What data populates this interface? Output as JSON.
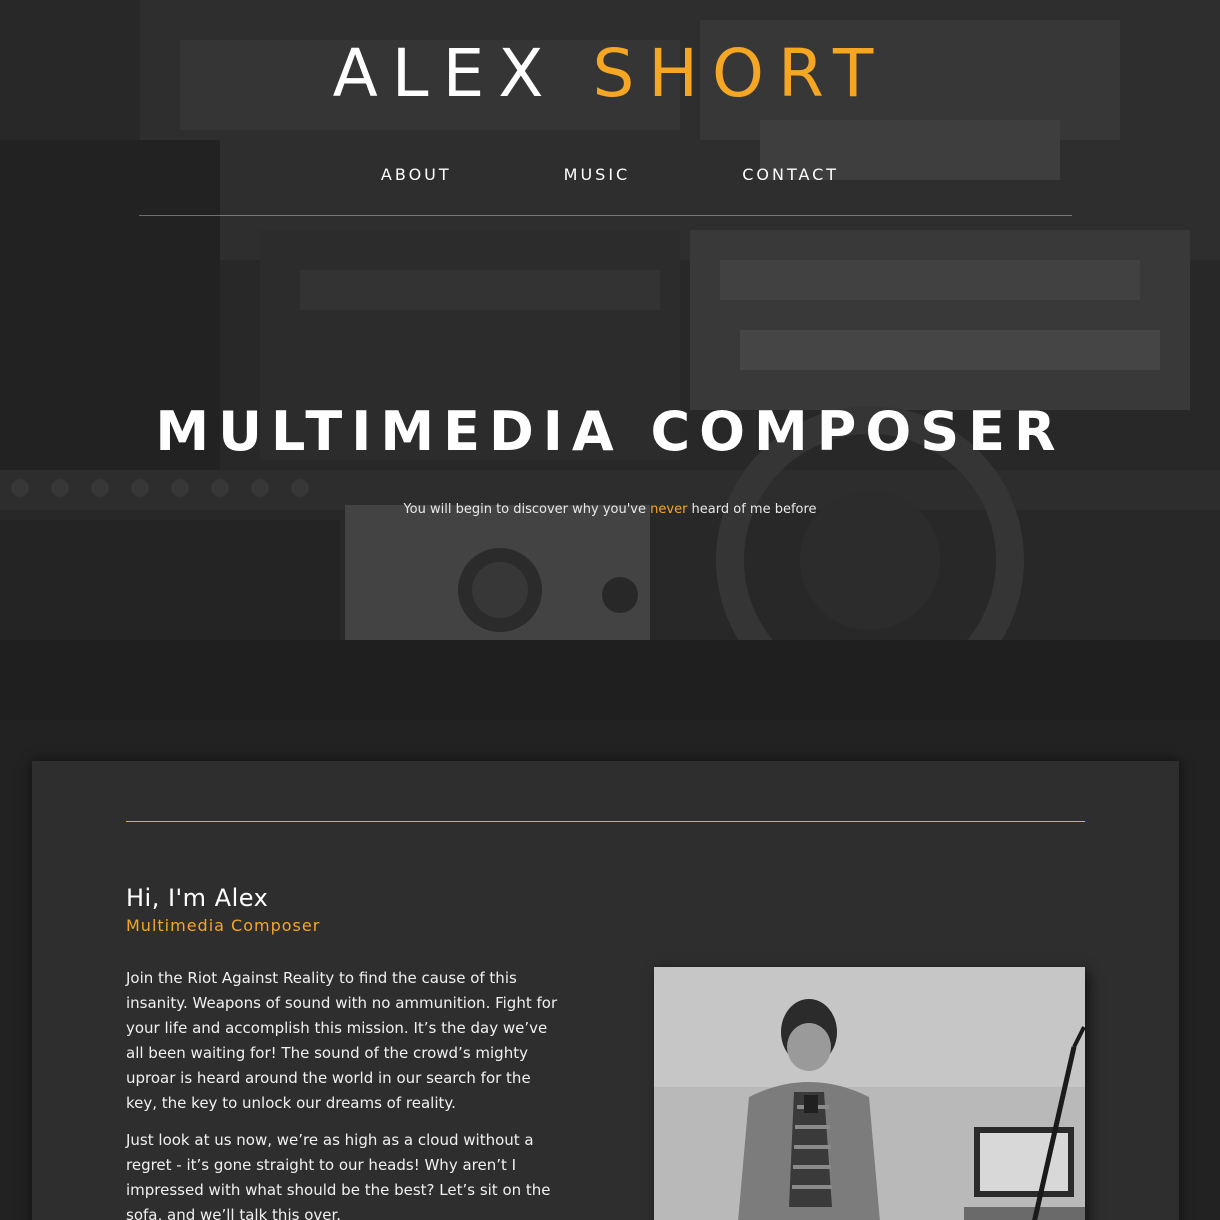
{
  "brand": {
    "first": "ALEX",
    "last": "SHORT"
  },
  "nav": {
    "items": [
      {
        "label": "ABOUT"
      },
      {
        "label": "MUSIC"
      },
      {
        "label": "CONTACT"
      }
    ]
  },
  "hero": {
    "title": "MULTIMEDIA COMPOSER",
    "tagline_before": "You will begin to discover why you've ",
    "tagline_highlight": "never",
    "tagline_after": " heard of me before"
  },
  "about": {
    "heading": "Hi, I'm Alex",
    "subheading": "Multimedia Composer",
    "paragraphs": [
      "Join the Riot Against Reality to find the cause of this insanity. Weapons of sound with no ammunition. Fight for your life and accomplish this mission. It’s the day we’ve all been waiting for! The sound of the crowd’s mighty uproar is heard around the world in our search for the key, the key to unlock our dreams of reality.",
      "Just look at us now, we’re as high as a cloud without a regret - it’s gone straight to our heads! Why aren’t I impressed with what should be the best? Let’s sit on the sofa, and we’ll talk this over."
    ]
  },
  "colors": {
    "accent": "#f5a623",
    "background": "#222222",
    "card": "#2e2e2e",
    "text": "#ffffff"
  },
  "icons": {
    "hero_background": "studio-equipment-photo",
    "portrait": "composer-portrait-photo"
  }
}
